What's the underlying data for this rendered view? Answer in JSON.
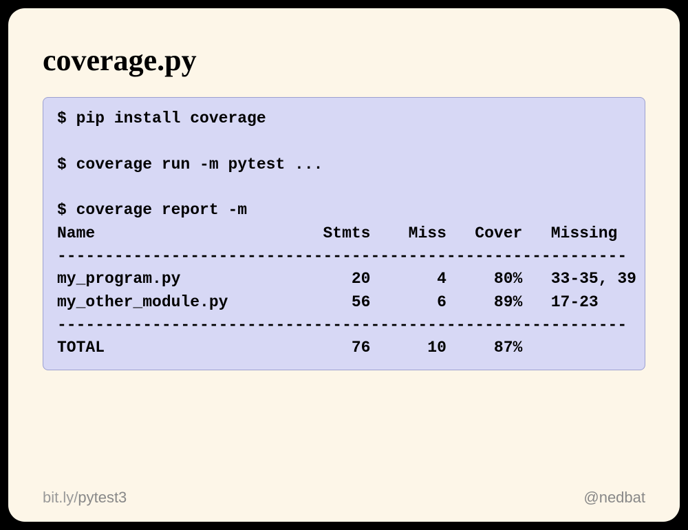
{
  "title": "coverage.py",
  "commands": [
    "$ pip install coverage",
    "$ coverage run -m pytest ...",
    "$ coverage report -m"
  ],
  "report": {
    "headers": [
      "Name",
      "Stmts",
      "Miss",
      "Cover",
      "Missing"
    ],
    "rows": [
      {
        "name": "my_program.py",
        "stmts": 20,
        "miss": 4,
        "cover": "80%",
        "missing": "33-35, 39"
      },
      {
        "name": "my_other_module.py",
        "stmts": 56,
        "miss": 6,
        "cover": "89%",
        "missing": "17-23"
      }
    ],
    "total": {
      "name": "TOTAL",
      "stmts": 76,
      "miss": 10,
      "cover": "87%",
      "missing": ""
    }
  },
  "footer": {
    "left_prefix": "bit.ly/",
    "left_suffix": "pytest3",
    "right": "@nedbat"
  }
}
